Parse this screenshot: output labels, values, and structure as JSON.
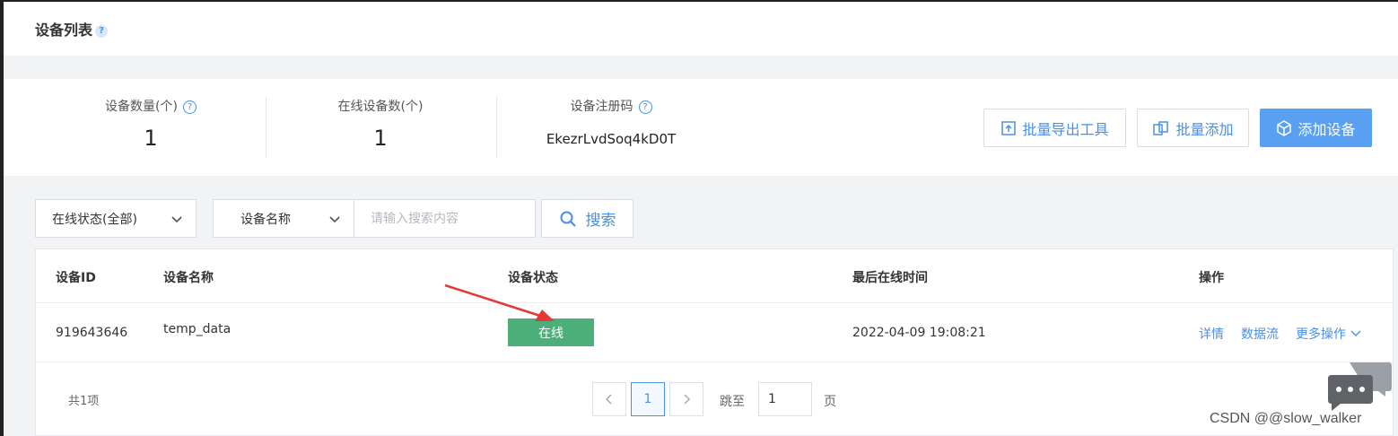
{
  "page": {
    "title": "设备列表",
    "title_help": "?"
  },
  "stats": {
    "device_count_label": "设备数量(个)",
    "device_count_value": "1",
    "online_count_label": "在线设备数(个)",
    "online_count_value": "1",
    "reg_code_label": "设备注册码",
    "reg_code_value": "EkezrLvdSoq4kD0T",
    "help": "?"
  },
  "actions": {
    "export_tool": "批量导出工具",
    "batch_add": "批量添加",
    "add_device": "添加设备"
  },
  "filters": {
    "status_select": "在线状态(全部)",
    "field_select": "设备名称",
    "search_placeholder": "请输入搜索内容",
    "search_button": "搜索"
  },
  "table": {
    "columns": [
      "设备ID",
      "设备名称",
      "设备状态",
      "最后在线时间",
      "操作"
    ],
    "rows": [
      {
        "id": "919643646",
        "name": "temp_data",
        "status": "在线",
        "last_online": "2022-04-09 19:08:21",
        "ops": [
          "详情",
          "数据流",
          "更多操作"
        ]
      }
    ]
  },
  "pagination": {
    "total": "共1项",
    "current_page": "1",
    "jump_label": "跳至",
    "jump_value": "1",
    "page_suffix": "页"
  },
  "watermark": "CSDN @@slow_walker",
  "colors": {
    "accent": "#4a90e2",
    "primary_button": "#5aa0f2",
    "online_status": "#4caf7a",
    "arrow": "#e53935"
  }
}
